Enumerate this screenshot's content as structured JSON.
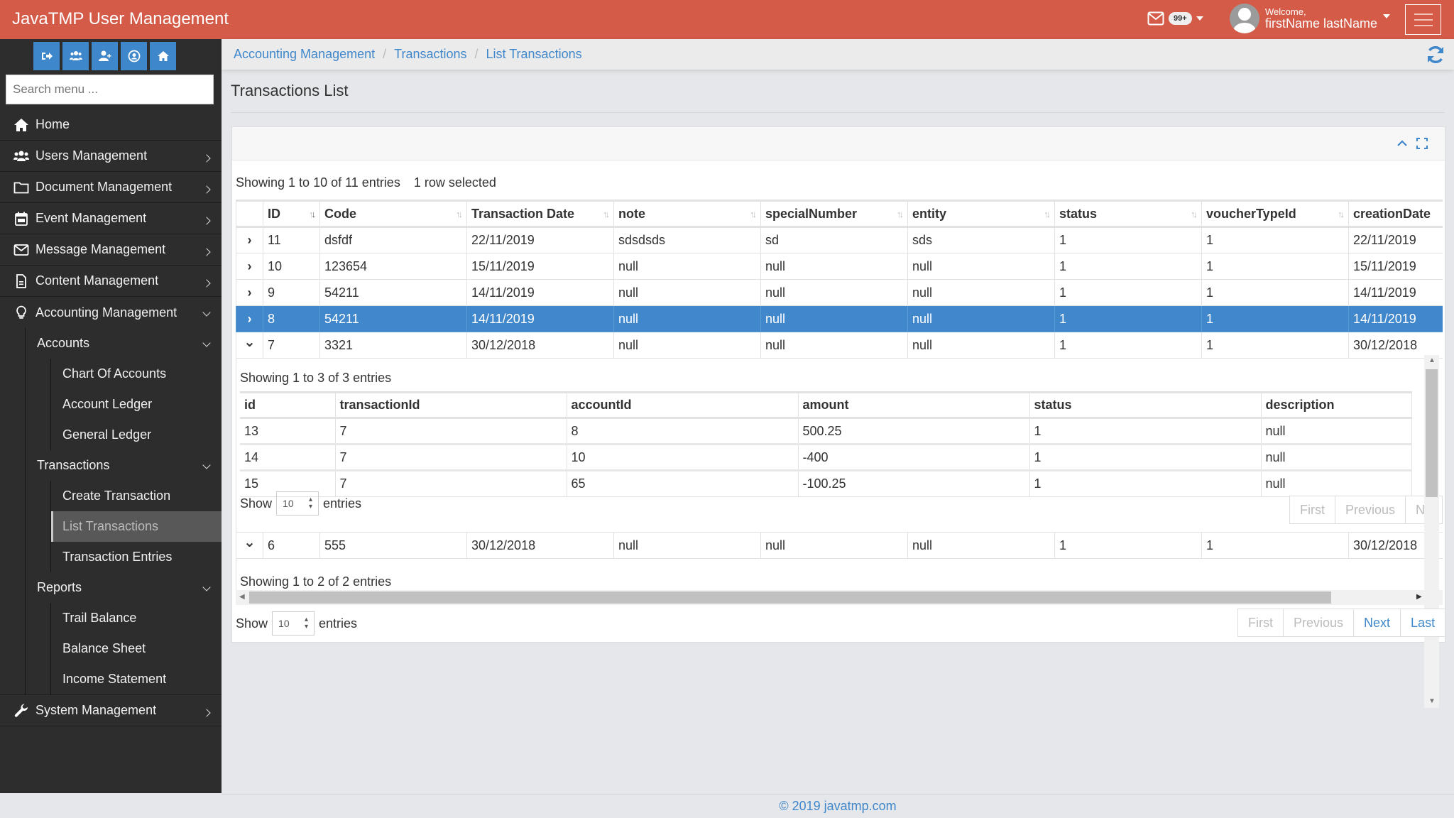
{
  "header": {
    "brand": "JavaTMP User Management",
    "messages_badge": "99+",
    "welcome": "Welcome,",
    "user_name": "firstName lastName"
  },
  "sidebar": {
    "quick_buttons": [
      "sign-out",
      "users",
      "add-user",
      "user-circle",
      "home"
    ],
    "search_placeholder": "Search menu ...",
    "items": [
      {
        "label": "Home",
        "icon": "home-icon"
      },
      {
        "label": "Users Management",
        "icon": "users-icon"
      },
      {
        "label": "Document Management",
        "icon": "folder-icon"
      },
      {
        "label": "Event Management",
        "icon": "calendar-icon"
      },
      {
        "label": "Message Management",
        "icon": "envelope-icon"
      },
      {
        "label": "Content Management",
        "icon": "file-icon"
      },
      {
        "label": "Accounting Management",
        "icon": "lightbulb-icon"
      },
      {
        "label": "System Management",
        "icon": "wrench-icon"
      }
    ],
    "accounting": {
      "accounts": {
        "label": "Accounts",
        "children": [
          "Chart Of Accounts",
          "Account Ledger",
          "General Ledger"
        ]
      },
      "transactions": {
        "label": "Transactions",
        "children": [
          "Create Transaction",
          "List Transactions",
          "Transaction Entries"
        ]
      },
      "reports": {
        "label": "Reports",
        "children": [
          "Trail Balance",
          "Balance Sheet",
          "Income Statement"
        ]
      }
    }
  },
  "breadcrumb": [
    "Accounting Management",
    "Transactions",
    "List Transactions"
  ],
  "page_title": "Transactions List",
  "table": {
    "info": "Showing 1 to 10 of 11 entries",
    "selection_info": "1 row selected",
    "columns": [
      "ID",
      "Code",
      "Transaction Date",
      "note",
      "specialNumber",
      "entity",
      "status",
      "voucherTypeId",
      "creationDate"
    ],
    "rows": [
      {
        "id": "11",
        "code": "dsfdf",
        "date": "22/11/2019",
        "note": "sdsdsds",
        "special": "sd",
        "entity": "sds",
        "status": "1",
        "voucher": "1",
        "created": "22/11/2019",
        "expanded": false,
        "selected": false
      },
      {
        "id": "10",
        "code": "123654",
        "date": "15/11/2019",
        "note": "null",
        "special": "null",
        "entity": "null",
        "status": "1",
        "voucher": "1",
        "created": "15/11/2019",
        "expanded": false,
        "selected": false
      },
      {
        "id": "9",
        "code": "54211",
        "date": "14/11/2019",
        "note": "null",
        "special": "null",
        "entity": "null",
        "status": "1",
        "voucher": "1",
        "created": "14/11/2019",
        "expanded": false,
        "selected": false
      },
      {
        "id": "8",
        "code": "54211",
        "date": "14/11/2019",
        "note": "null",
        "special": "null",
        "entity": "null",
        "status": "1",
        "voucher": "1",
        "created": "14/11/2019",
        "expanded": false,
        "selected": true
      },
      {
        "id": "7",
        "code": "3321",
        "date": "30/12/2018",
        "note": "null",
        "special": "null",
        "entity": "null",
        "status": "1",
        "voucher": "1",
        "created": "30/12/2018",
        "expanded": true,
        "selected": false
      },
      {
        "id": "6",
        "code": "555",
        "date": "30/12/2018",
        "note": "null",
        "special": "null",
        "entity": "null",
        "status": "1",
        "voucher": "1",
        "created": "30/12/2018",
        "expanded": true,
        "selected": false
      }
    ],
    "length_label_pre": "Show",
    "length_value": "10",
    "length_label_post": "entries",
    "pagination": [
      "First",
      "Previous",
      "Next",
      "Last"
    ]
  },
  "entries_7": {
    "info": "Showing 1 to 3 of 3 entries",
    "columns": [
      "id",
      "transactionId",
      "accountId",
      "amount",
      "status",
      "description"
    ],
    "rows": [
      [
        "13",
        "7",
        "8",
        "500.25",
        "1",
        "null"
      ],
      [
        "14",
        "7",
        "10",
        "-400",
        "1",
        "null"
      ],
      [
        "15",
        "7",
        "65",
        "-100.25",
        "1",
        "null"
      ]
    ],
    "length_label_pre": "Show",
    "length_value": "10",
    "length_label_post": "entries",
    "pagination": [
      "First",
      "Previous",
      "Ne"
    ]
  },
  "entries_6": {
    "info": "Showing 1 to 2 of 2 entries"
  },
  "footer": "© 2019 javatmp.com",
  "colors": {
    "header": "#d35b47",
    "sidebar": "#2d2d2d",
    "accent": "#3f87cb",
    "selected_row": "#4187cc"
  }
}
